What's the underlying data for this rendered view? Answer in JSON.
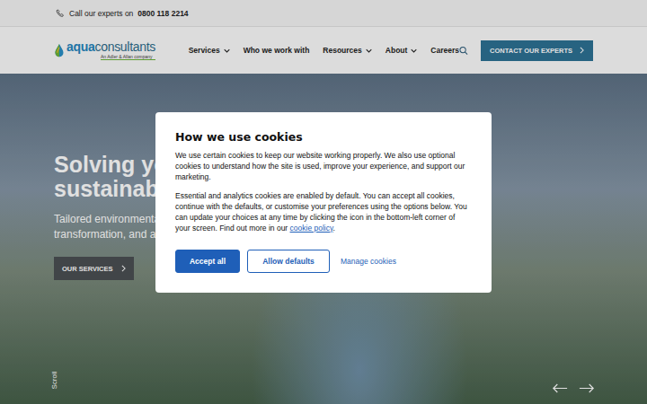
{
  "topbar": {
    "phone_label": "Call our experts on",
    "phone_number": "0800 118 2214"
  },
  "logo": {
    "primary": "aqua",
    "secondary": "consultants",
    "tagline": "An Adler & Allan company"
  },
  "nav": [
    {
      "label": "Services",
      "dropdown": true
    },
    {
      "label": "Who we work with",
      "dropdown": false
    },
    {
      "label": "Resources",
      "dropdown": true
    },
    {
      "label": "About",
      "dropdown": true
    },
    {
      "label": "Careers",
      "dropdown": false
    }
  ],
  "contact_button": {
    "label": "CONTACT OUR EXPERTS"
  },
  "hero": {
    "title_lines": [
      "Solving you",
      "sustainable"
    ],
    "subtitle_lines": [
      "Tailored environmental",
      "transformation, and ac"
    ],
    "button": {
      "label": "OUR SERVICES"
    },
    "scroll_label": "Scroll"
  },
  "cookie_dialog": {
    "title": "How we use cookies",
    "paragraphs": [
      {
        "text": "We use certain cookies to keep our website working properly. We also use optional cookies to understand how the site is used, improve your experience, and support our marketing.",
        "link": "",
        "after": ""
      },
      {
        "text": "Essential and analytics cookies are enabled by default. You can accept all cookies, continue with the defaults, or customise your preferences using the options below. You can update your choices at any time by clicking the icon in the bottom-left corner of your screen. Find out more in our ",
        "link": "cookie policy",
        "after": "."
      }
    ],
    "buttons": [
      {
        "label": "Accept all",
        "kind": "primary"
      },
      {
        "label": "Allow defaults",
        "kind": "outline"
      },
      {
        "label": "Manage cookies",
        "kind": "link"
      }
    ]
  }
}
